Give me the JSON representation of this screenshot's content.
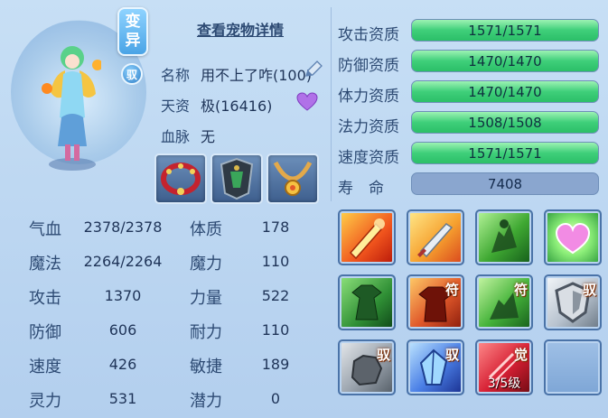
{
  "header": {
    "transform_tag": [
      "变",
      "异"
    ],
    "bound_badge": "驭",
    "detail_link": "查看宠物详情"
  },
  "info": {
    "name_label": "名称",
    "name_value": "用不上了咋(100)",
    "talent_label": "天资",
    "talent_value": "极(16416)",
    "bloodline_label": "血脉",
    "bloodline_value": "无"
  },
  "equipment": [
    {
      "name": "collar-item"
    },
    {
      "name": "armor-item"
    },
    {
      "name": "necklace-item"
    }
  ],
  "stats": {
    "hp": {
      "label": "气血",
      "value": "2378/2378"
    },
    "mp": {
      "label": "魔法",
      "value": "2264/2264"
    },
    "attack": {
      "label": "攻击",
      "value": "1370"
    },
    "defense": {
      "label": "防御",
      "value": "606"
    },
    "speed": {
      "label": "速度",
      "value": "426"
    },
    "spirit": {
      "label": "灵力",
      "value": "531"
    },
    "constitution": {
      "label": "体质",
      "value": "178"
    },
    "magic": {
      "label": "魔力",
      "value": "110"
    },
    "strength": {
      "label": "力量",
      "value": "522"
    },
    "endurance": {
      "label": "耐力",
      "value": "110"
    },
    "agility": {
      "label": "敏捷",
      "value": "189"
    },
    "potential": {
      "label": "潜力",
      "value": "0"
    }
  },
  "aptitudes": [
    {
      "label": "攻击资质",
      "value": "1571/1571",
      "fill": 1.0
    },
    {
      "label": "防御资质",
      "value": "1470/1470",
      "fill": 1.0
    },
    {
      "label": "体力资质",
      "value": "1470/1470",
      "fill": 1.0
    },
    {
      "label": "法力资质",
      "value": "1508/1508",
      "fill": 1.0
    },
    {
      "label": "速度资质",
      "value": "1571/1571",
      "fill": 1.0
    }
  ],
  "lifespan": {
    "label": "寿　命",
    "value": "7408"
  },
  "skills": [
    {
      "name": "flame-sword-skill",
      "mark": ""
    },
    {
      "name": "holy-sword-skill",
      "mark": ""
    },
    {
      "name": "shadow-strike-skill",
      "mark": ""
    },
    {
      "name": "heart-shield-skill",
      "mark": ""
    },
    {
      "name": "green-warrior-skill",
      "mark": ""
    },
    {
      "name": "red-demon-skill",
      "mark": "符"
    },
    {
      "name": "green-charge-skill",
      "mark": "符"
    },
    {
      "name": "silver-shield-skill",
      "mark": "驭"
    },
    {
      "name": "stone-fist-skill",
      "mark": "驭"
    },
    {
      "name": "crystal-skill",
      "mark": "驭"
    },
    {
      "name": "awaken-skill",
      "mark": "觉",
      "level": "3/5级"
    },
    {
      "name": "empty-skill-slot",
      "mark": ""
    }
  ],
  "colors": {
    "bar_fill": "#3fcf7a",
    "panel_bg": "#b9d5f0",
    "text": "#2d4a73"
  }
}
